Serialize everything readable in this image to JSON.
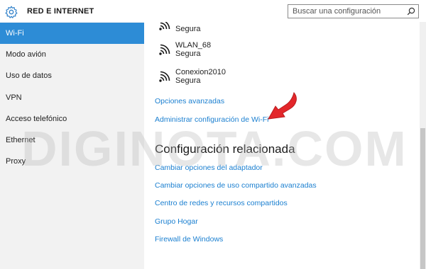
{
  "header": {
    "title": "RED E INTERNET",
    "search_placeholder": "Buscar una configuración"
  },
  "sidebar": {
    "items": [
      {
        "label": "Wi-Fi",
        "active": true
      },
      {
        "label": "Modo avión",
        "active": false
      },
      {
        "label": "Uso de datos",
        "active": false
      },
      {
        "label": "VPN",
        "active": false
      },
      {
        "label": "Acceso telefónico",
        "active": false
      },
      {
        "label": "Ethernet",
        "active": false
      },
      {
        "label": "Proxy",
        "active": false
      }
    ]
  },
  "main": {
    "networks": [
      {
        "name": "",
        "status": "Segura"
      },
      {
        "name": "WLAN_68",
        "status": "Segura"
      },
      {
        "name": "Conexion2010",
        "status": "Segura"
      }
    ],
    "advanced_link": "Opciones avanzadas",
    "manage_link": "Administrar configuración de Wi-Fi",
    "related": {
      "title": "Configuración relacionada",
      "links": [
        "Cambiar opciones del adaptador",
        "Cambiar opciones de uso compartido avanzadas",
        "Centro de redes y recursos compartidos",
        "Grupo Hogar",
        "Firewall de Windows"
      ]
    }
  },
  "watermark": "DIGINOTA.COM",
  "colors": {
    "accent": "#2d8cd6",
    "link": "#1a7fd0",
    "sidebar_bg": "#f2f2f2",
    "arrow": "#e3262a"
  }
}
